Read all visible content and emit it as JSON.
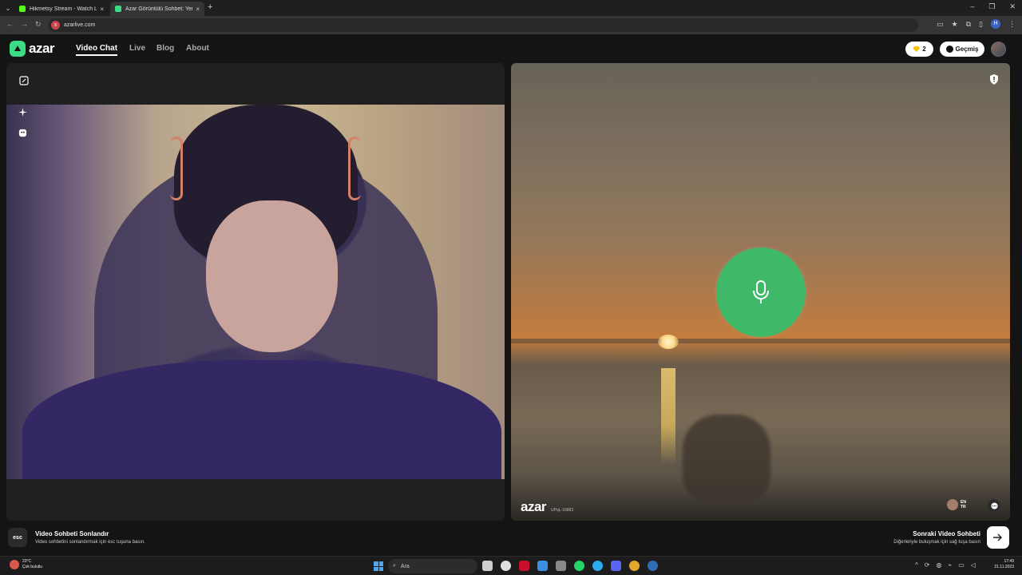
{
  "browser": {
    "tabs": [
      {
        "label": "Hikmetsy Stream - Watch Live ...",
        "favicon_color": "#53fc18",
        "active": false
      },
      {
        "label": "Azar Görüntülü Sohbet: Yer...",
        "favicon_color": "#3ddc84",
        "active": true
      }
    ],
    "close_glyph": "×",
    "new_tab_glyph": "+",
    "url": "azarlive.com",
    "profile_initial": "H"
  },
  "header": {
    "logo_text": "azar",
    "nav": [
      "Video Chat",
      "Live",
      "Blog",
      "About"
    ],
    "gems_count": "2",
    "history_label": "Geçmiş"
  },
  "remote": {
    "watermark": "azar",
    "user_id": "UPqL-16883",
    "peer_tags": [
      "EN",
      "TR"
    ]
  },
  "bottom": {
    "esc_key": "esc",
    "end_title": "Video Sohbeti Sonlandır",
    "end_sub": "Video sohbetini sonlandırmak için esc tuşuna basın.",
    "next_title": "Sonraki Video Sohbeti",
    "next_sub": "Diğerleriyle buluşmak için sağ tuşa basın"
  },
  "taskbar": {
    "weather_temp": "23°C",
    "weather_desc": "Çok bulutlu",
    "search_placeholder": "Ara",
    "time": "17:49",
    "date": "21.11.2023"
  },
  "colors": {
    "accent_green": "#3fb867",
    "brand_green": "#3ddc84",
    "gem_yellow": "#f6c40a"
  }
}
